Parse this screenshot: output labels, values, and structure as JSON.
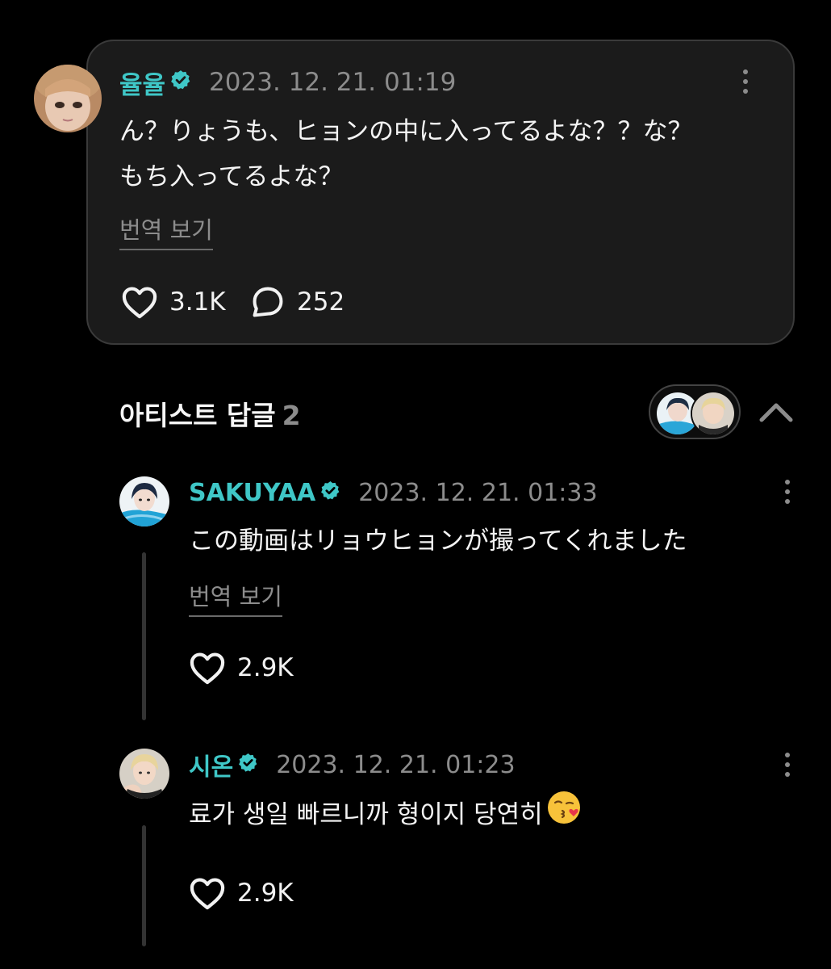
{
  "post": {
    "username": "율율",
    "timestamp": "2023. 12. 21. 01:19",
    "text_line1": "ん？りょうも、ヒョンの中に入ってるよな？？な？",
    "text_line2": "もち入ってるよな？",
    "translate_label": "번역 보기",
    "likes": "3.1K",
    "comments": "252"
  },
  "section": {
    "title": "아티스트 답글",
    "count": "2"
  },
  "replies": [
    {
      "username": "SAKUYAA",
      "timestamp": "2023. 12. 21. 01:33",
      "text": "この動画はリョウヒョンが撮ってくれました",
      "translate_label": "번역 보기",
      "likes": "2.9K"
    },
    {
      "username": "시온",
      "timestamp": "2023. 12. 21. 01:23",
      "text": "료가 생일 빠르니까 형이지 당연히",
      "likes": "2.9K"
    }
  ],
  "colors": {
    "accent": "#3fc7c7",
    "muted": "#8c8c8c",
    "card": "#1b1b1b"
  },
  "icons": [
    "verified-badge-icon",
    "more-options-icon",
    "heart-icon",
    "comment-bubble-icon",
    "chevron-up-icon",
    "kissing-face-emoji-icon"
  ]
}
